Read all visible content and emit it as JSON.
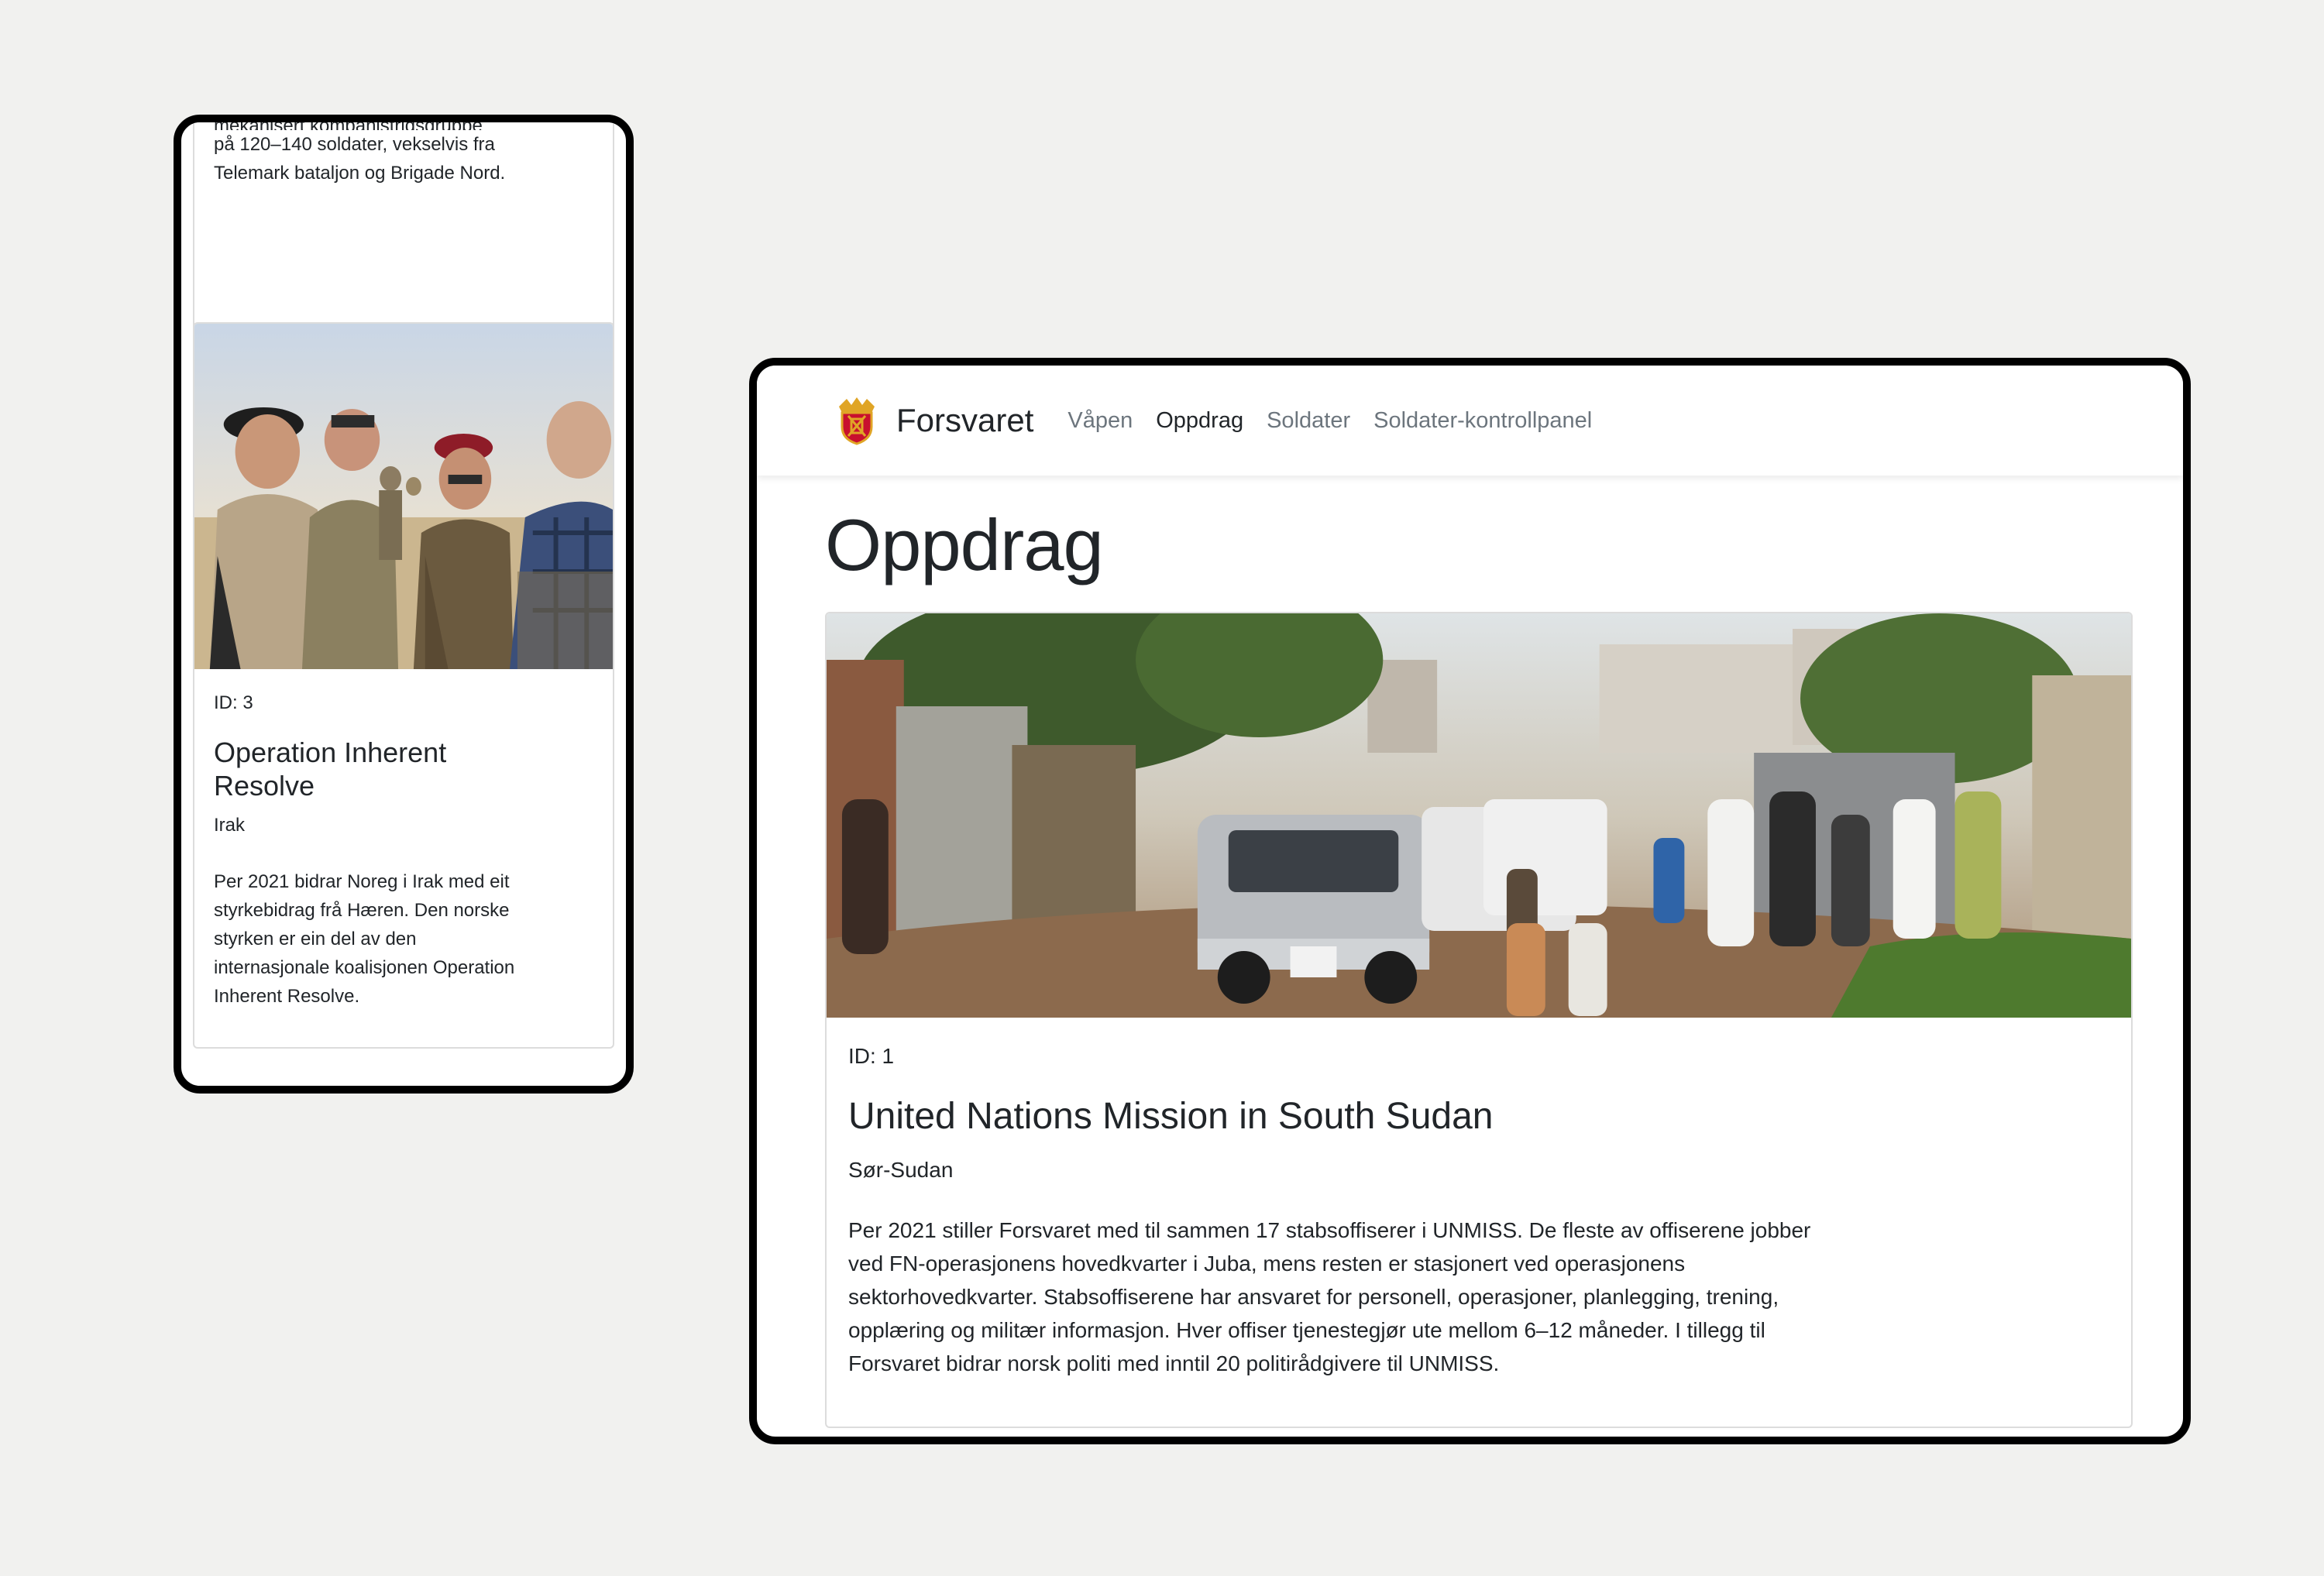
{
  "mobile": {
    "prev_card": {
      "clipped_line": "mekanisert kompanistridsgruppe",
      "description_rest": "på 120–140 soldater, vekselvis fra Telemark bataljon og Brigade Nord."
    },
    "card": {
      "id_label": "ID: 3",
      "title": "Operation Inherent Resolve",
      "location": "Irak",
      "description": "Per 2021 bidrar Noreg i Irak med eit styrkebidrag frå Hæren. Den norske styrken er ein del av den internasjonale koalisjonen Operation Inherent Resolve.",
      "image_icon": "soldiers-photo"
    }
  },
  "desktop": {
    "navbar": {
      "brand": "Forsvaret",
      "logo_icon": "forsvaret-crest-icon",
      "links": [
        "Våpen",
        "Oppdrag",
        "Soldater",
        "Soldater-kontrollpanel"
      ],
      "active_link": "Oppdrag"
    },
    "page_title": "Oppdrag",
    "card": {
      "id_label": "ID: 1",
      "title": "United Nations Mission in South Sudan",
      "location": "Sør-Sudan",
      "description": "Per 2021 stiller Forsvaret med til sammen 17 stabsoffiserer i UNMISS. De fleste av offiserene jobber ved FN-operasjonens hovedkvarter i Juba, mens resten er stasjonert ved operasjonens sektorhovedkvarter. Stabsoffiserene har ansvaret for personell, operasjoner, planlegging, trening, opplæring og militær informasjon. Hver offiser tjenestegjør ute mellom 6–12 måneder. I tillegg til Forsvaret bidrar norsk politi med inntil 20 politirådgivere til UNMISS.",
      "image_icon": "street-scene-photo"
    }
  },
  "colors": {
    "background": "#f1f1ef",
    "text": "#212529",
    "muted_nav": "#6c757d",
    "crest_red": "#c8102e",
    "crest_gold": "#e0a526"
  }
}
